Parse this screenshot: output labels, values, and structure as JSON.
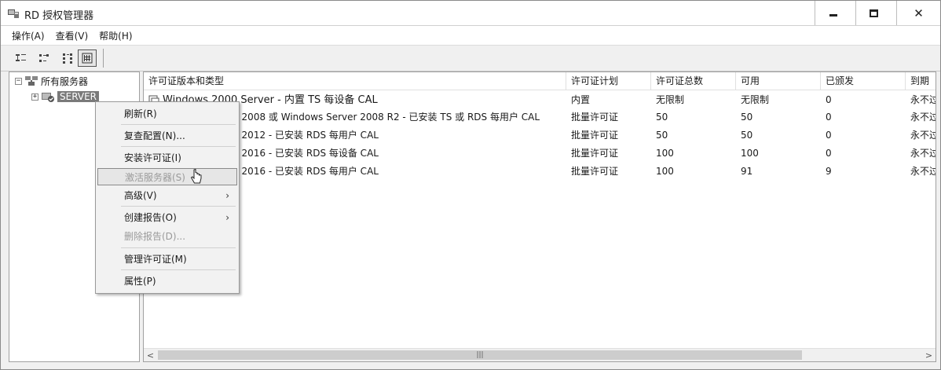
{
  "window": {
    "title": "RD 授权管理器"
  },
  "menubar": {
    "items": [
      "操作(A)",
      "查看(V)",
      "帮助(H)"
    ]
  },
  "toolbar": {
    "buttons": [
      "tree-view-icon",
      "small-icons-view-icon",
      "details-view-icon",
      "list-view-icon"
    ]
  },
  "tree": {
    "root": "所有服务器",
    "server": "SERVER"
  },
  "list": {
    "columns": [
      "许可证版本和类型",
      "许可证计划",
      "许可证总数",
      "可用",
      "已颁发",
      "到期"
    ],
    "rows": [
      {
        "type": "Windows 2000 Server - 内置 TS 每设备 CAL",
        "plan": "内置",
        "total": "无限制",
        "available": "无限制",
        "issued": "0",
        "expiry": "永不过"
      },
      {
        "type": "Windows Server 2008 或 Windows Server 2008 R2 - 已安装 TS 或 RDS 每用户 CAL",
        "plan": "批量许可证",
        "total": "50",
        "available": "50",
        "issued": "0",
        "expiry": "永不过"
      },
      {
        "type": "Windows Server 2012 - 已安装 RDS 每用户 CAL",
        "plan": "批量许可证",
        "total": "50",
        "available": "50",
        "issued": "0",
        "expiry": "永不过"
      },
      {
        "type": "Windows Server 2016 - 已安装 RDS 每设备 CAL",
        "plan": "批量许可证",
        "total": "100",
        "available": "100",
        "issued": "0",
        "expiry": "永不过"
      },
      {
        "type": "Windows Server 2016 - 已安装 RDS 每用户 CAL",
        "plan": "批量许可证",
        "total": "100",
        "available": "91",
        "issued": "9",
        "expiry": "永不过"
      }
    ]
  },
  "context_menu": {
    "refresh": "刷新(R)",
    "review_config": "复查配置(N)...",
    "install_licenses": "安装许可证(I)",
    "activate_server": "激活服务器(S)",
    "advanced": "高级(V)",
    "create_report": "创建报告(O)",
    "delete_report": "删除报告(D)...",
    "manage_licenses": "管理许可证(M)",
    "properties": "属性(P)"
  }
}
